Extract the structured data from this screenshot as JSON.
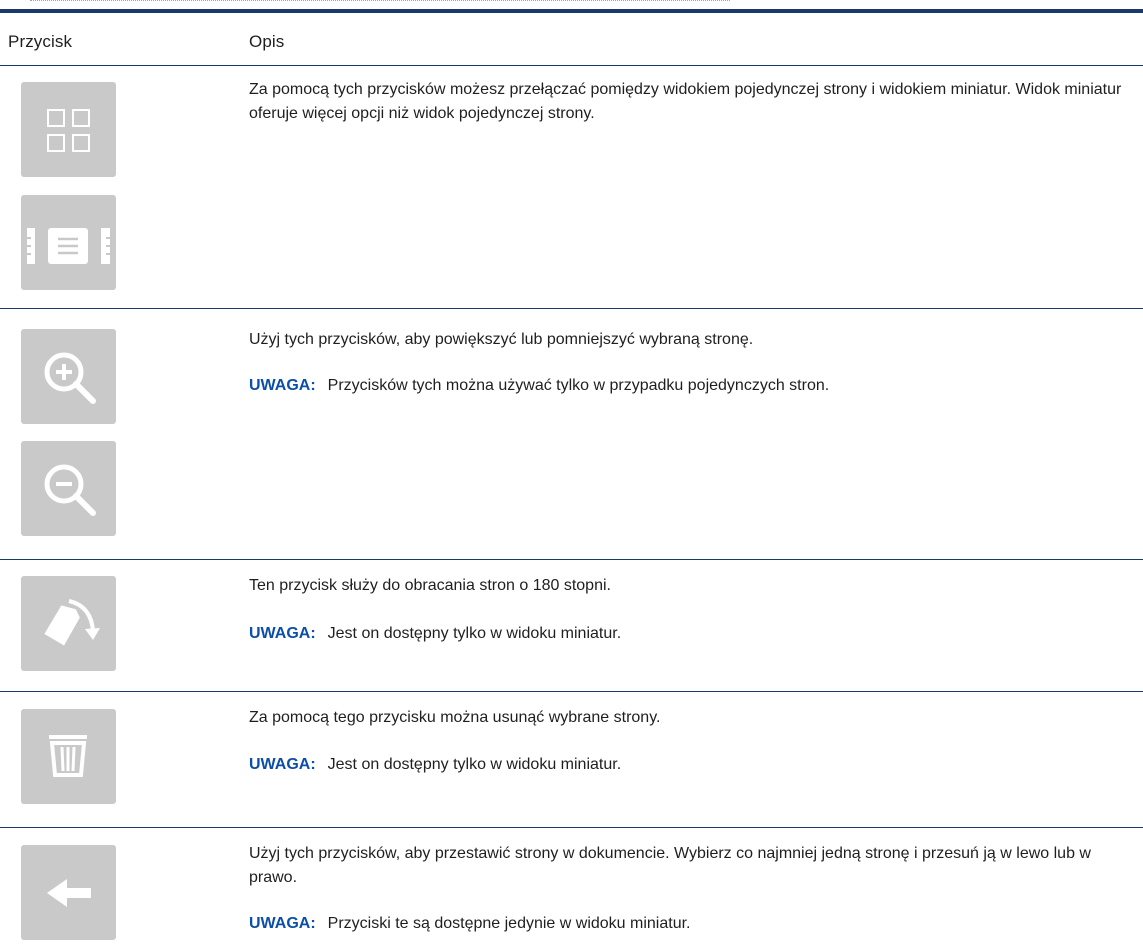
{
  "table": {
    "headers": {
      "button": "Przycisk",
      "description": "Opis"
    },
    "note_label": "UWAGA:",
    "rows": [
      {
        "icons": [
          "grid-view-icon",
          "single-page-view-icon"
        ],
        "description": "Za pomocą tych przycisków możesz przełączać pomiędzy widokiem pojedynczej strony i widokiem miniatur. Widok miniatur oferuje więcej opcji niż widok pojedynczej strony.",
        "note": ""
      },
      {
        "icons": [
          "zoom-in-icon",
          "zoom-out-icon"
        ],
        "description": "Użyj tych przycisków, aby powiększyć lub pomniejszyć wybraną stronę.",
        "note": "Przycisków tych można używać tylko w przypadku pojedynczych stron."
      },
      {
        "icons": [
          "rotate-page-icon"
        ],
        "description": "Ten przycisk służy do obracania stron o 180 stopni.",
        "note": "Jest on dostępny tylko w widoku miniatur."
      },
      {
        "icons": [
          "trash-icon"
        ],
        "description": "Za pomocą tego przycisku można usunąć wybrane strony.",
        "note": "Jest on dostępny tylko w widoku miniatur."
      },
      {
        "icons": [
          "arrow-left-icon"
        ],
        "description": "Użyj tych przycisków, aby przestawić strony w dokumencie. Wybierz co najmniej jedną stronę i przesuń ją w lewo lub w prawo.",
        "note": "Przyciski te są dostępne jedynie w widoku miniatur."
      }
    ]
  },
  "colors": {
    "rule": "#1a3a6b",
    "button_bg": "#c9c9c9",
    "icon": "#ffffff",
    "note_label": "#0b4fa8"
  }
}
